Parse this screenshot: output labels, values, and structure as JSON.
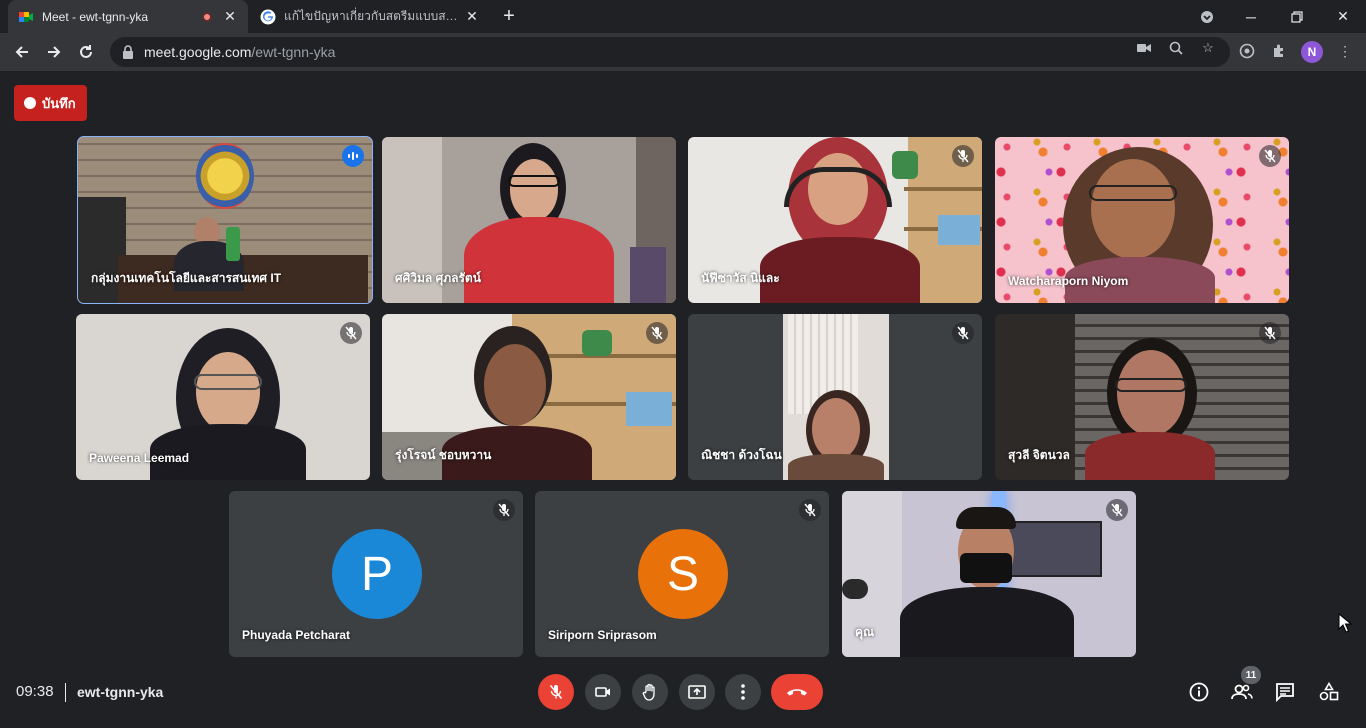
{
  "browser": {
    "tabs": [
      {
        "title": "Meet - ewt-tgnn-yka",
        "active": true,
        "recording": true
      },
      {
        "title": "แก้ไขปัญหาเกี่ยวกับสตรีมแบบสด - Go",
        "active": false
      }
    ],
    "url_host": "meet.google.com",
    "url_path": "/ewt-tgnn-yka",
    "profile_initial": "N"
  },
  "meet": {
    "record_label": "บันทึก",
    "participants": [
      {
        "name": "กลุ่มงานเทคโนโลยีและสารสนเทศ IT",
        "speaking": true
      },
      {
        "name": "ศศิวิมล ศุภลรัตน์"
      },
      {
        "name": "นัฟีซาวัส นิและ"
      },
      {
        "name": "Watcharaporn Niyom"
      },
      {
        "name": "Paweena Leemad"
      },
      {
        "name": "รุ่งโรจน์ ชอบหวาน"
      },
      {
        "name": "ณิชชา ด้วงโฉน"
      },
      {
        "name": "สุวลี จิตนวล"
      },
      {
        "name": "Phuyada Petcharat",
        "initial": "P",
        "avatar_color": "#1a88d6"
      },
      {
        "name": "Siriporn Sriprasom",
        "initial": "S",
        "avatar_color": "#e8710a"
      },
      {
        "name": "คุณ"
      }
    ],
    "clock": "09:38",
    "meeting_code": "ewt-tgnn-yka",
    "participant_count": "11"
  }
}
